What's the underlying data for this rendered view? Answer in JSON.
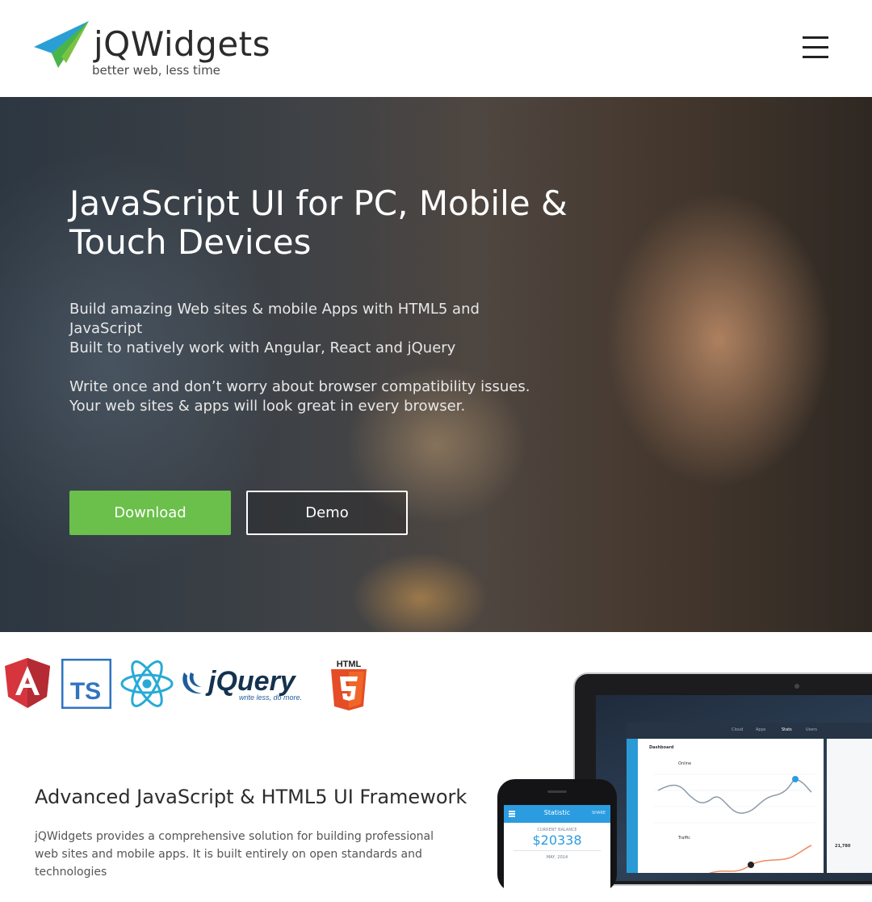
{
  "header": {
    "brand_name": "jQWidgets",
    "tagline": "better web, less time",
    "menu_icon": "hamburger-menu-icon"
  },
  "hero": {
    "title": "JavaScript UI for PC, Mobile & Touch Devices",
    "lines": [
      "Build amazing Web sites & mobile Apps with HTML5 and JavaScript",
      "Built to natively work with Angular, React and jQuery",
      "Write once and don’t worry about browser compatibility issues. Your web sites & apps will look great in every browser."
    ],
    "download_label": "Download",
    "demo_label": "Demo",
    "colors": {
      "download": "#6ac04a",
      "demo_border": "#ffffff"
    }
  },
  "tech_logos": {
    "items": [
      "angular-logo-icon",
      "typescript-logo-icon",
      "react-logo-icon",
      "jquery-logo-icon",
      "html5-logo-icon"
    ],
    "typescript_text": "TS",
    "jquery_text": "jQuery",
    "jquery_slogan": "write less, do more.",
    "html5_text": "HTML"
  },
  "section": {
    "title": "Advanced JavaScript & HTML5 UI Framework",
    "body": "jQWidgets provides a comprehensive solution for building professional web sites and mobile apps. It is built entirely on open standards and technologies"
  },
  "laptop": {
    "tabs": [
      "Cloud",
      "Apps",
      "Stats",
      "Users"
    ],
    "dashboard_title": "Dashboard",
    "chart_label_online": "Online",
    "chart_label_traffic": "Traffic",
    "side_value": "21,780"
  },
  "phone": {
    "title": "Statistic",
    "share": "SHARE",
    "caption": "CURRENT BALANCE",
    "balance": "$20338",
    "date": "MAY, 2014"
  }
}
